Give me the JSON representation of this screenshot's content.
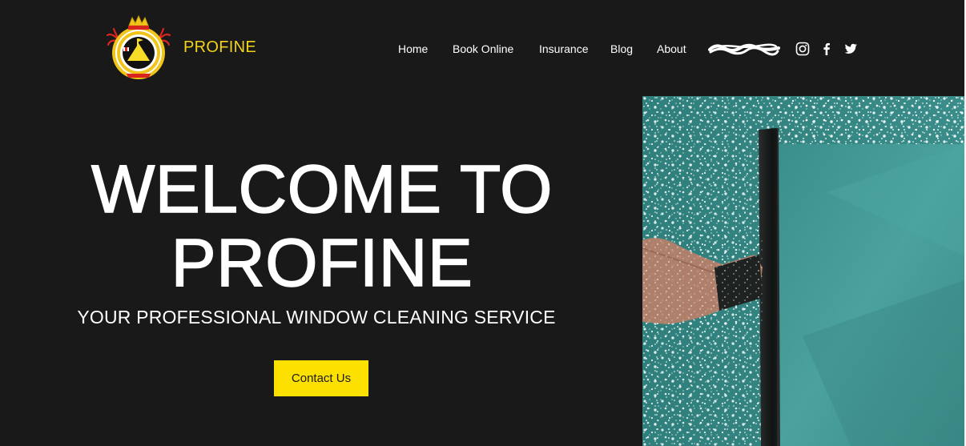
{
  "header": {
    "brand_name": "PROFINE",
    "logo_icon": "crown-emblem-icon",
    "nav": [
      {
        "label": "Home"
      },
      {
        "label": "Book Online"
      },
      {
        "label": "Insurance"
      },
      {
        "label": "Blog"
      },
      {
        "label": "About"
      }
    ],
    "social": [
      {
        "icon": "instagram-icon"
      },
      {
        "icon": "facebook-icon"
      },
      {
        "icon": "twitter-icon"
      }
    ]
  },
  "hero": {
    "title_line1": "WELCOME TO",
    "title_line2": "PROFINE",
    "subtitle": "YOUR PROFESSIONAL WINDOW CLEANING SERVICE",
    "cta_label": "Contact Us",
    "image": "window-squeegee-photo"
  },
  "colors": {
    "background": "#191919",
    "brand_yellow": "#f3d31a",
    "button_yellow": "#fce100",
    "text_white": "#ffffff",
    "glass_teal": "#3d918e"
  }
}
